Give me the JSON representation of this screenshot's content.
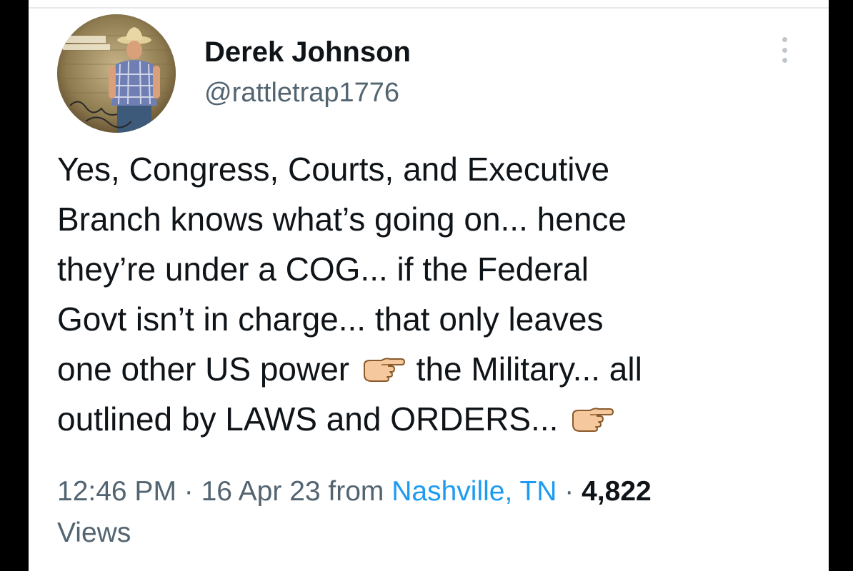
{
  "tweet": {
    "author": {
      "name": "Derek Johnson",
      "handle": "@rattletrap1776"
    },
    "text_lines": [
      "Yes, Congress, Courts, and Executive",
      "Branch knows what’s going on... hence",
      "they’re under a COG... if the Federal",
      "Govt isn’t in charge... that only leaves"
    ],
    "text_line5_before": "one other US power ",
    "text_line5_after": " the Military... all",
    "text_line6": "outlined by LAWS and ORDERS... ",
    "emoji_icon": "backhand-index-pointing-right-icon",
    "time": "12:46 PM",
    "separator": " · ",
    "date": "16 Apr 23",
    "from_label": " from ",
    "location": "Nashville, TN",
    "views_count": "4,822",
    "views_label": "Views"
  },
  "colors": {
    "text_primary": "#0f1419",
    "text_secondary": "#536471",
    "link": "#1d9bf0",
    "background": "#ffffff",
    "frame": "#000000"
  }
}
